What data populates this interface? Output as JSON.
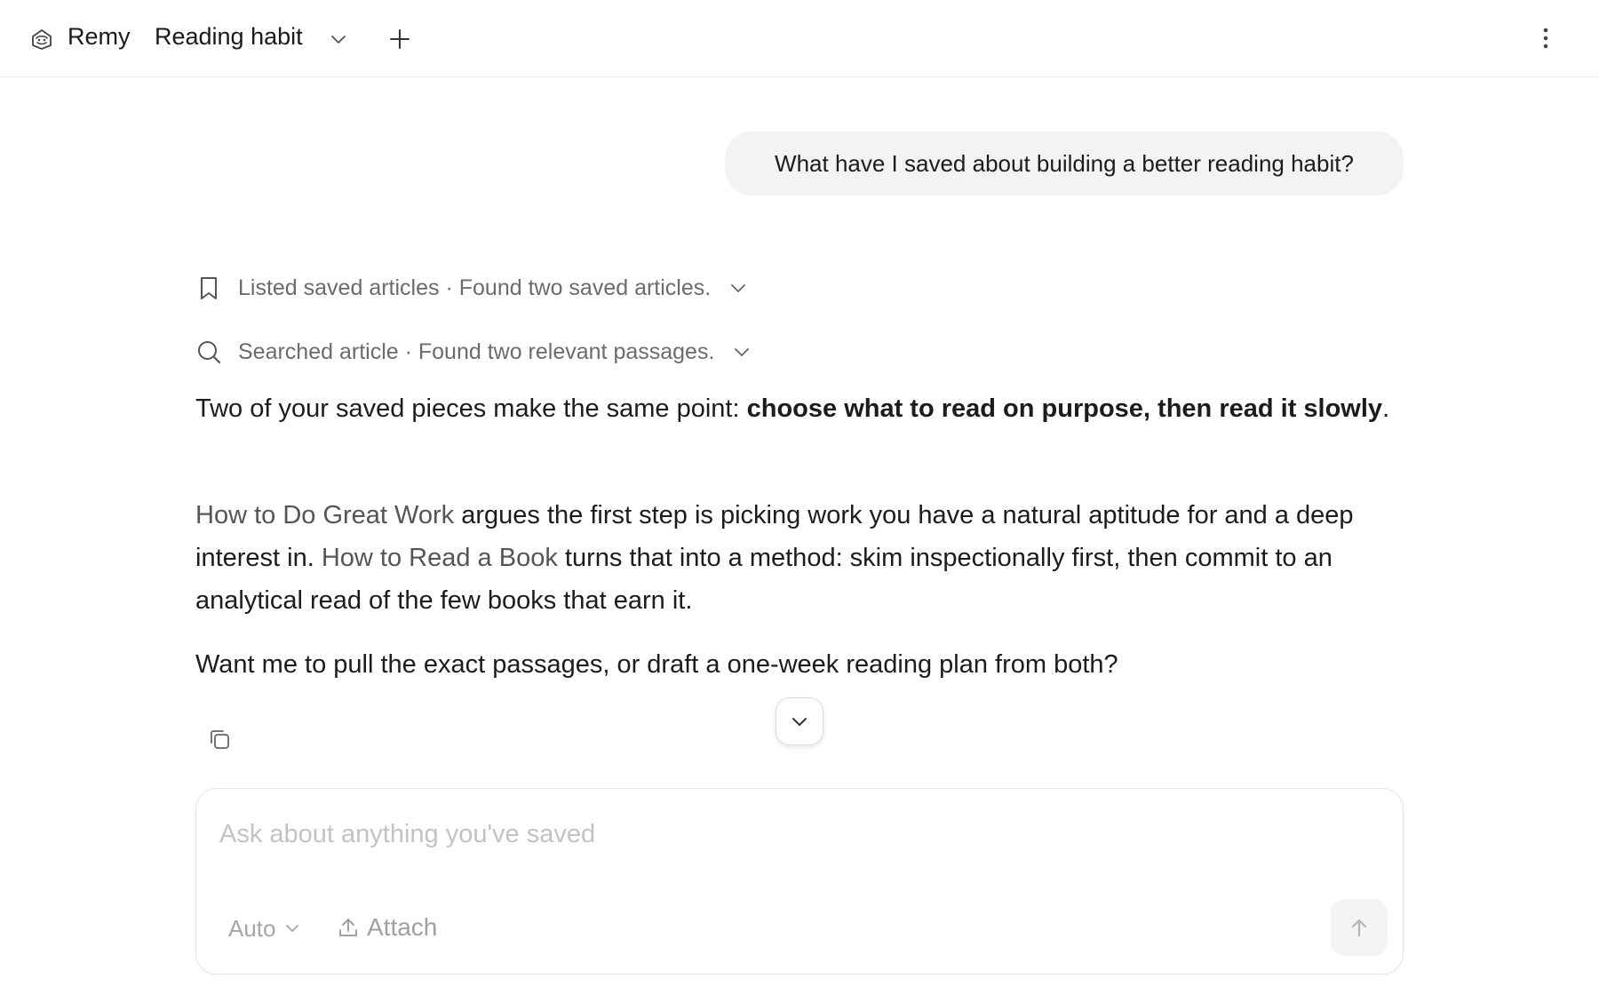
{
  "header": {
    "app_name": "Remy",
    "chat_title": "Reading habit",
    "icons": {
      "logo": "remy-logo-icon",
      "title_menu": "chevron-down-icon",
      "new_chat": "plus-icon",
      "more": "more-vertical-icon"
    }
  },
  "conversation": {
    "user_message": "What have I saved about building a better reading habit?",
    "tool_steps": [
      {
        "icon": "bookmark-icon",
        "action": "Listed saved articles",
        "separator": " · ",
        "result": "Found two saved articles."
      },
      {
        "icon": "search-icon",
        "action": "Searched article",
        "separator": " · ",
        "result": "Found two relevant passages."
      }
    ],
    "answer": {
      "p1_intro": "Two of your saved pieces make the same point: ",
      "p1_bold": "choose what to read on purpose, then read it slowly",
      "p1_end": ".",
      "p2_link1": "How to Do Great Work",
      "p2_text1": " argues the first step is picking work you have a natural aptitude for and a deep interest in. ",
      "p2_link2": "How to Read a Book",
      "p2_text2": " turns that into a method: skim inspectionally first, then commit to an analytical read of the few books that earn it.",
      "p3": "Want me to pull the exact passages, or draft a one-week reading plan from both?"
    }
  },
  "composer": {
    "placeholder": "Ask about anything you've saved",
    "value": "",
    "mode": "Auto",
    "attach_label": "Attach"
  },
  "colors": {
    "text": "#1c1c1c",
    "muted": "#6b6b6b",
    "link": "#555555",
    "bubble": "#f3f3f3",
    "border": "#e6e6e6"
  }
}
